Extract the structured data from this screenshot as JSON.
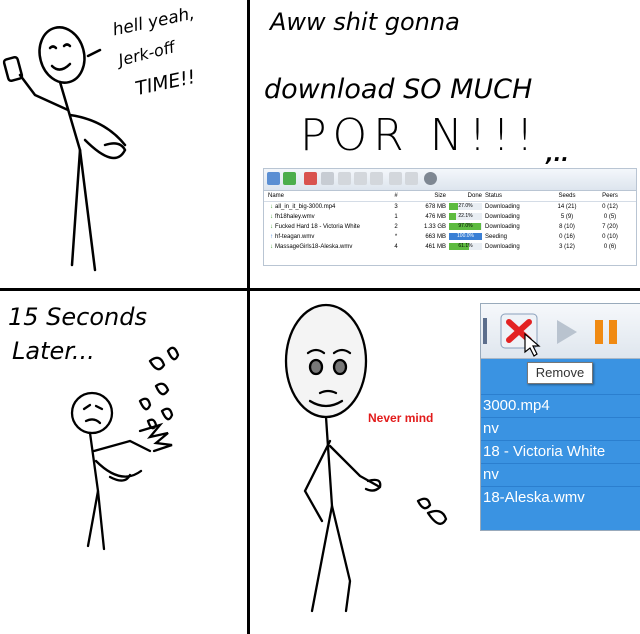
{
  "panel1": {
    "speech_line1": "hell yeah,",
    "speech_line2": "Jerk-off",
    "speech_line3": "TIME!!"
  },
  "panel2": {
    "line1": "Aww shit  gonna",
    "line2": "download SO MUCH",
    "line3": "POR N!!!",
    "ellipsis": ",..",
    "torrent_client": {
      "columns": [
        "Name",
        "#",
        "Size",
        "Done",
        "Status",
        "Seeds",
        "Peers"
      ],
      "rows": [
        {
          "name": "all_in_it_big-3000.mp4",
          "num": "3",
          "size": "678 MB",
          "done": "27.0%",
          "done_value": 27.0,
          "status": "Downloading",
          "seeds": "14 (21)",
          "peers": "0 (12)",
          "icon": "download-arrow-icon"
        },
        {
          "name": "fh18haley.wmv",
          "num": "1",
          "size": "476 MB",
          "done": "22.1%",
          "done_value": 22.1,
          "status": "Downloading",
          "seeds": "5 (9)",
          "peers": "0 (5)",
          "icon": "download-arrow-icon"
        },
        {
          "name": "Fucked Hard 18 - Victoria White",
          "num": "2",
          "size": "1.33 GB",
          "done": "97.0%",
          "done_value": 97.0,
          "status": "Downloading",
          "seeds": "8 (10)",
          "peers": "7 (20)",
          "icon": "download-arrow-icon"
        },
        {
          "name": "hf-teagan.wmv",
          "num": "*",
          "size": "663 MB",
          "done": "100.0%",
          "done_value": 100.0,
          "status": "Seeding",
          "seeds": "0 (16)",
          "peers": "0 (10)",
          "icon": "upload-arrow-icon"
        },
        {
          "name": "MassageGirls18-Aleska.wmv",
          "num": "4",
          "size": "461 MB",
          "done": "61.1%",
          "done_value": 61.1,
          "status": "Downloading",
          "seeds": "3 (12)",
          "peers": "0 (6)",
          "icon": "download-arrow-icon"
        }
      ],
      "colors": {
        "downloading": "#5dbb3f",
        "seeding": "#3a7fd5",
        "download_icon": "#3d9b2a",
        "upload_icon": "#3478d4"
      }
    }
  },
  "panel3": {
    "line1": "15 Seconds",
    "line2": "Later..."
  },
  "panel4": {
    "caption": "Never mind",
    "tooltip": "Remove",
    "zoom_rows": [
      "3000.mp4",
      "nv",
      "18 - Victoria White",
      "nv",
      "18-Aleska.wmv"
    ],
    "colors": {
      "selection": "#3a93e2",
      "remove_x": "#e32222",
      "pause": "#f08a12",
      "caption": "#e21b1b"
    }
  }
}
